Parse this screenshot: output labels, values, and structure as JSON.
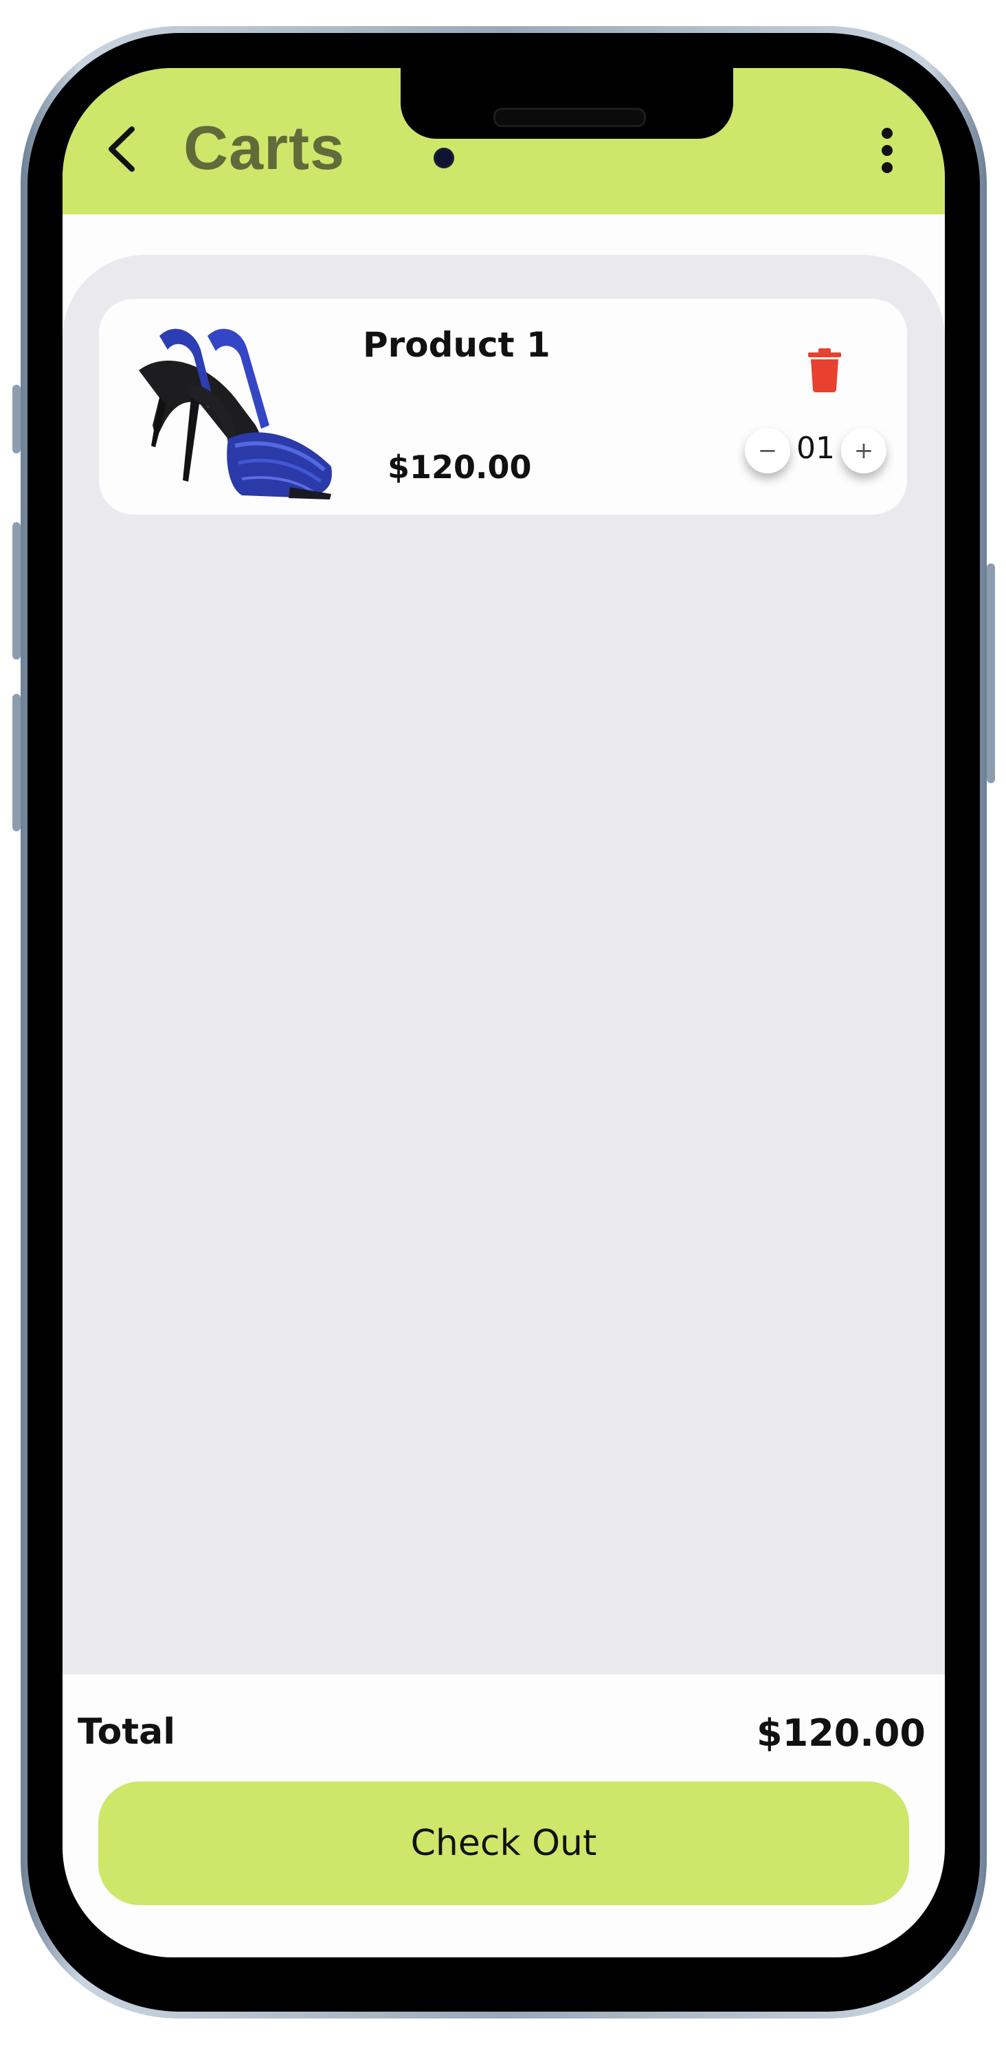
{
  "header": {
    "title": "Carts",
    "back_icon": "chevron-left-icon",
    "menu_icon": "more-vertical-icon",
    "color": "#cce76a"
  },
  "cart": {
    "items": [
      {
        "name": "Product 1",
        "price": "$120.00",
        "quantity": "01",
        "image": "blue-slingback-heel"
      }
    ]
  },
  "summary": {
    "total_label": "Total",
    "total_value": "$120.00",
    "checkout_label": "Check Out"
  },
  "colors": {
    "accent": "#cce76a",
    "delete": "#e8412f",
    "content_bg": "#eae9ee"
  }
}
